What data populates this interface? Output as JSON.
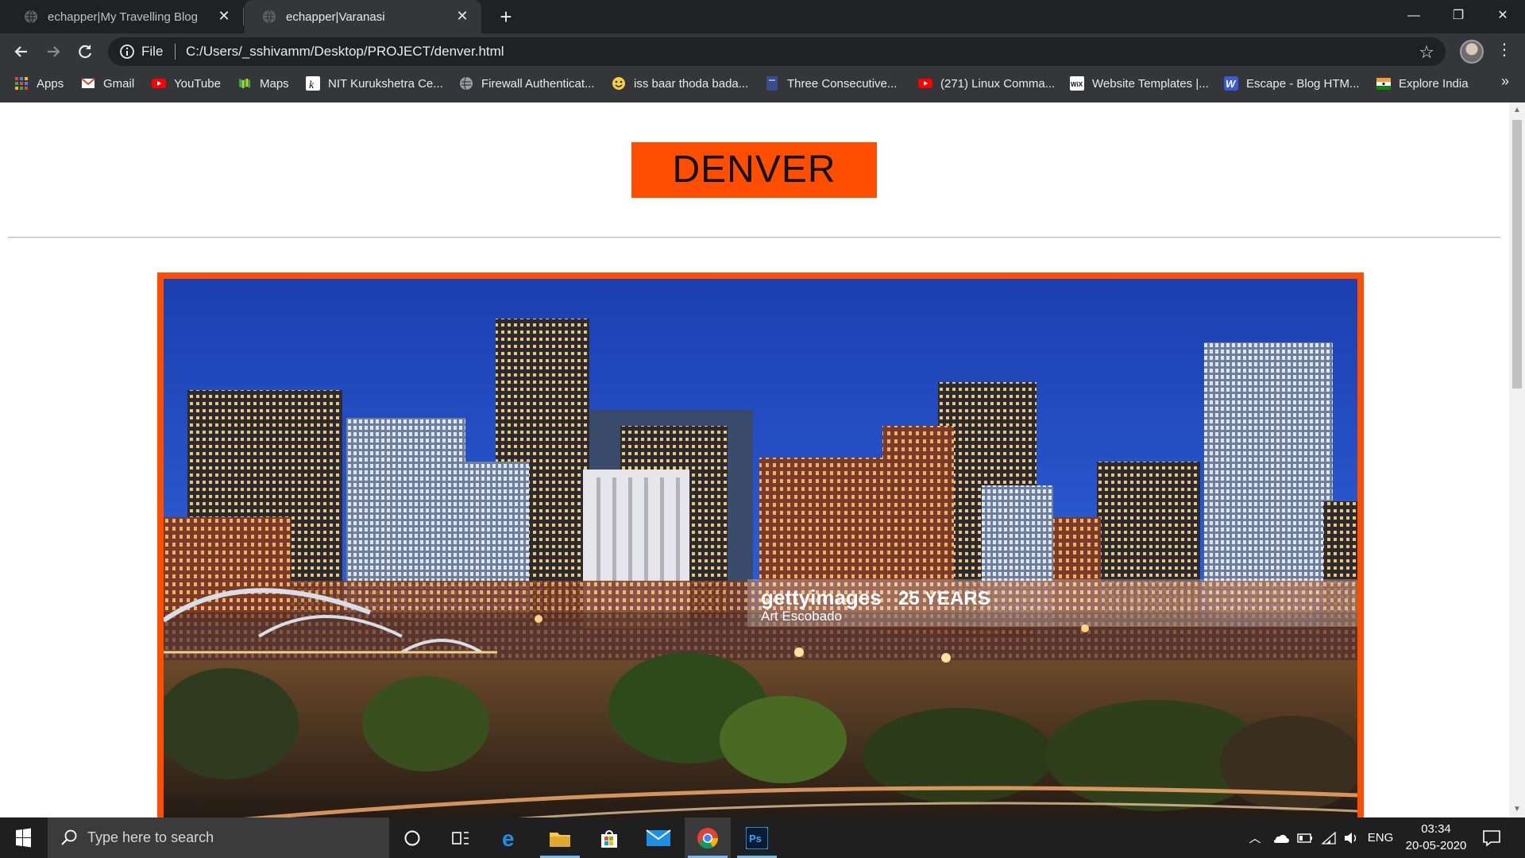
{
  "browser": {
    "tabs": [
      {
        "title": "echapper|My Travelling Blog",
        "active": false
      },
      {
        "title": "echapper|Varanasi",
        "active": true
      }
    ],
    "omnibox": {
      "scheme_label": "File",
      "url": "C:/Users/_sshivamm/Desktop/PROJECT/denver.html"
    },
    "bookmarks": [
      {
        "label": "Apps",
        "icon": "apps-grid-icon",
        "color": "#ea4335"
      },
      {
        "label": "Gmail",
        "icon": "gmail-icon",
        "color": "#ea4335"
      },
      {
        "label": "YouTube",
        "icon": "youtube-icon",
        "color": "#ff0000"
      },
      {
        "label": "Maps",
        "icon": "maps-icon",
        "color": "#34a853"
      },
      {
        "label": "NIT Kurukshetra Ce...",
        "icon": "nit-icon",
        "color": "#ffffff"
      },
      {
        "label": "Firewall Authenticat...",
        "icon": "globe-icon",
        "color": "#9aa0a6"
      },
      {
        "label": "iss baar thoda bada...",
        "icon": "smiley-icon",
        "color": "#f4d03f"
      },
      {
        "label": "Three Consecutive...",
        "icon": "page-icon",
        "color": "#3a4a8a"
      },
      {
        "label": "(271) Linux Comma...",
        "icon": "youtube-icon",
        "color": "#ff0000"
      },
      {
        "label": "Website Templates |...",
        "icon": "wix-icon",
        "color": "#ffffff"
      },
      {
        "label": "Escape - Blog HTM...",
        "icon": "w-icon",
        "color": "#3b5bdb"
      },
      {
        "label": "Explore India",
        "icon": "india-flag-icon",
        "color": "#ff9933"
      }
    ],
    "bookmarks_more": "»"
  },
  "page": {
    "title": "DENVER",
    "accent_color": "#ff4e00",
    "image": {
      "subject": "Denver skyline at dusk",
      "watermark_brand": "gettyimages",
      "watermark_badge": "25 YEARS",
      "watermark_credit": "Art Escobado"
    }
  },
  "taskbar": {
    "search_placeholder": "Type here to search",
    "apps": [
      "cortana-icon",
      "task-view-icon",
      "edge-icon",
      "file-explorer-icon",
      "store-icon",
      "mail-icon",
      "chrome-icon",
      "photoshop-icon"
    ],
    "active_app": "chrome-icon",
    "language": "ENG",
    "time": "03:34",
    "date": "20-05-2020"
  }
}
